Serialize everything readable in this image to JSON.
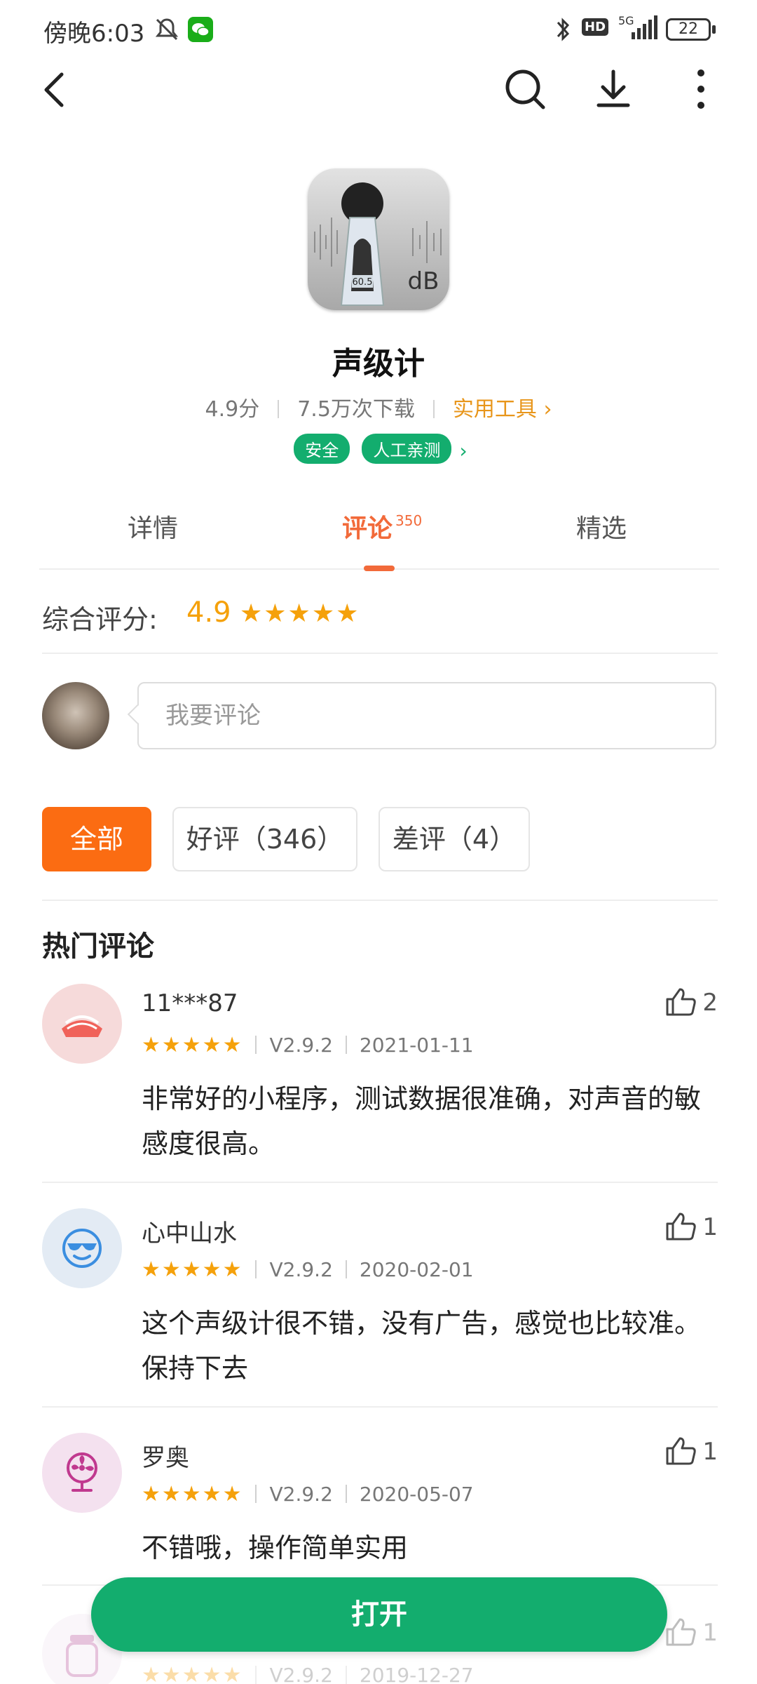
{
  "status_bar": {
    "time": "傍晚6:03",
    "hd_label": "HD",
    "network_label": "5G",
    "battery": "22"
  },
  "nav": {
    "back_icon": "chevron-left-icon",
    "search_icon": "search-icon",
    "download_icon": "download-icon",
    "more_icon": "more-vertical-icon"
  },
  "app": {
    "name": "声级计",
    "score": "4.9分",
    "downloads": "7.5万次下载",
    "category": "实用工具",
    "category_chevron": "›",
    "icon_label": "dB",
    "icon_display": "60.5",
    "badges": [
      "安全",
      "人工亲测"
    ],
    "badge_chevron": "›"
  },
  "tabs": [
    {
      "label": "详情",
      "count": "",
      "active": false
    },
    {
      "label": "评论",
      "count": "350",
      "active": true
    },
    {
      "label": "精选",
      "count": "",
      "active": false
    }
  ],
  "overall": {
    "label": "综合评分:",
    "score": "4.9",
    "stars": "★★★★★"
  },
  "comment_box": {
    "placeholder": "我要评论"
  },
  "filters": [
    {
      "label": "全部",
      "active": true
    },
    {
      "label": "好评（346）",
      "active": false
    },
    {
      "label": "差评（4）",
      "active": false
    }
  ],
  "section_title": "热门评论",
  "reviews": [
    {
      "user": "11***87",
      "stars": "★★★★★",
      "version": "V2.9.2",
      "date": "2021-01-11",
      "text": "非常好的小程序，测试数据很准确，对声音的敏感度很高。",
      "likes": "2",
      "avatar_icon": "sushi-icon",
      "avatar_bg": "#f6dada"
    },
    {
      "user": "心中山水",
      "stars": "★★★★★",
      "version": "V2.9.2",
      "date": "2020-02-01",
      "text": "这个声级计很不错，没有广告，感觉也比较准。保持下去",
      "likes": "1",
      "avatar_icon": "cool-face-icon",
      "avatar_bg": "#e3ebf4"
    },
    {
      "user": "罗奥",
      "stars": "★★★★★",
      "version": "V2.9.2",
      "date": "2020-05-07",
      "text": "不错哦，操作简单实用",
      "likes": "1",
      "avatar_icon": "fan-icon",
      "avatar_bg": "#f4e1ef"
    },
    {
      "user": "",
      "stars": "★★★★★",
      "version": "V2.9.2",
      "date": "2019-12-27",
      "text": "",
      "likes": "1",
      "avatar_icon": "jar-icon",
      "avatar_bg": "#f1e6f1"
    }
  ],
  "open_button": "打开",
  "colors": {
    "accent_orange": "#fb6c12",
    "tab_active": "#f26a3a",
    "star": "#f5a10b",
    "category": "#e8961b",
    "green": "#13ad6e"
  }
}
